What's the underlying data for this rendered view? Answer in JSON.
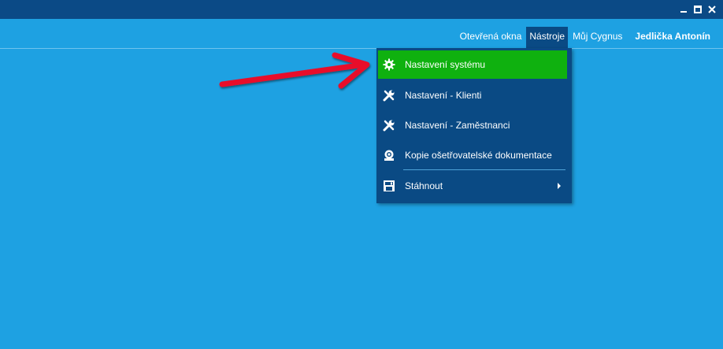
{
  "window": {
    "controls": [
      {
        "name": "minimize",
        "icon": "minimize-icon"
      },
      {
        "name": "maximize",
        "icon": "maximize-icon"
      },
      {
        "name": "close",
        "icon": "close-icon"
      }
    ]
  },
  "menubar": {
    "items": [
      {
        "label": "Otevřená okna"
      },
      {
        "label": "Nástroje"
      },
      {
        "label": "Můj Cygnus"
      },
      {
        "label": "Jedlička Antonín"
      }
    ]
  },
  "dropdown": {
    "items": [
      {
        "label": "Nastavení systému",
        "icon": "gear-icon",
        "highlighted": true
      },
      {
        "label": "Nastavení - Klienti",
        "icon": "tools-icon"
      },
      {
        "label": "Nastavení - Zaměstnanci",
        "icon": "tools-icon"
      },
      {
        "label": "Kopie ošetřovatelské dokumentace",
        "icon": "document-copy-icon"
      },
      {
        "label": "Stáhnout",
        "icon": "save-icon",
        "has_submenu": true
      }
    ]
  },
  "colors": {
    "background": "#1ea1e2",
    "titlebar": "#0b4a86",
    "dropdown": "#0a4a84",
    "highlight": "#0fb10f",
    "annotation_arrow": "#e8102a"
  }
}
